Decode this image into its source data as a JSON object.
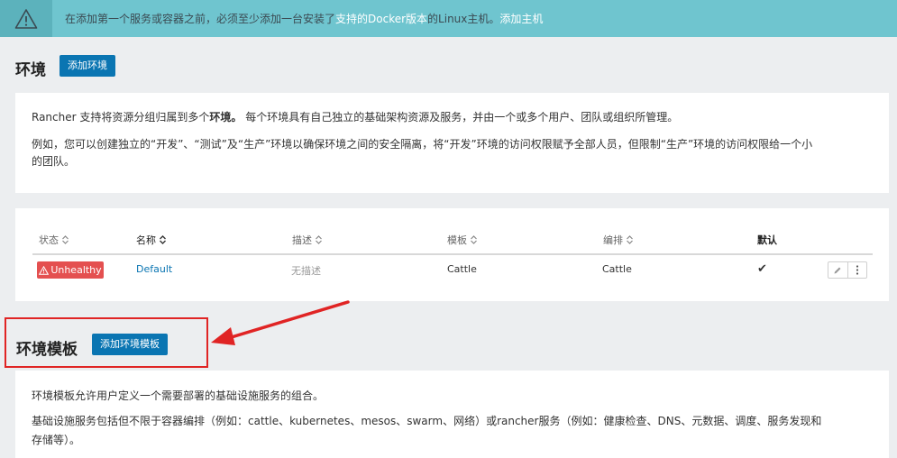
{
  "banner": {
    "text_before": "在添加第一个服务或容器之前，必须至少添加一台安装了",
    "link_docker": "支持的Docker版本",
    "text_after": "的Linux主机。",
    "link_add_host": "添加主机"
  },
  "environments": {
    "title": "环境",
    "add_button": "添加环境",
    "desc_line1_before": "Rancher 支持将资源分组归属到多个",
    "desc_line1_bold": "环境。",
    "desc_line1_after": " 每个环境具有自己独立的基础架构资源及服务，并由一个或多个用户、团队或组织所管理。",
    "desc_line2": "例如，您可以创建独立的“开发”、“测试”及“生产”环境以确保环境之间的安全隔离，将“开发”环境的访问权限赋予全部人员，但限制“生产”环境的访问权限给一个小",
    "desc_line3": "的团队。"
  },
  "table": {
    "headers": {
      "state": "状态",
      "name": "名称",
      "description": "描述",
      "template": "模板",
      "orchestration": "编排",
      "default": "默认"
    },
    "rows": [
      {
        "state": "Unhealthy",
        "name": "Default",
        "description": "无描述",
        "template": "Cattle",
        "orchestration": "Cattle",
        "is_default": "✔"
      }
    ]
  },
  "templates": {
    "title": "环境模板",
    "add_button": "添加环境模板",
    "desc_line1": "环境模板允许用户定义一个需要部署的基础设施服务的组合。",
    "desc_line2": "基础设施服务包括但不限于容器编排（例如：cattle、kubernetes、mesos、swarm、网络）或rancher服务（例如：健康检查、DNS、元数据、调度、服务发现和",
    "desc_line3": "存储等）。"
  },
  "colors": {
    "banner_bg": "#6fc5cf",
    "primary": "#0a75b2",
    "unhealthy": "#e45050",
    "highlight": "#e02424"
  }
}
